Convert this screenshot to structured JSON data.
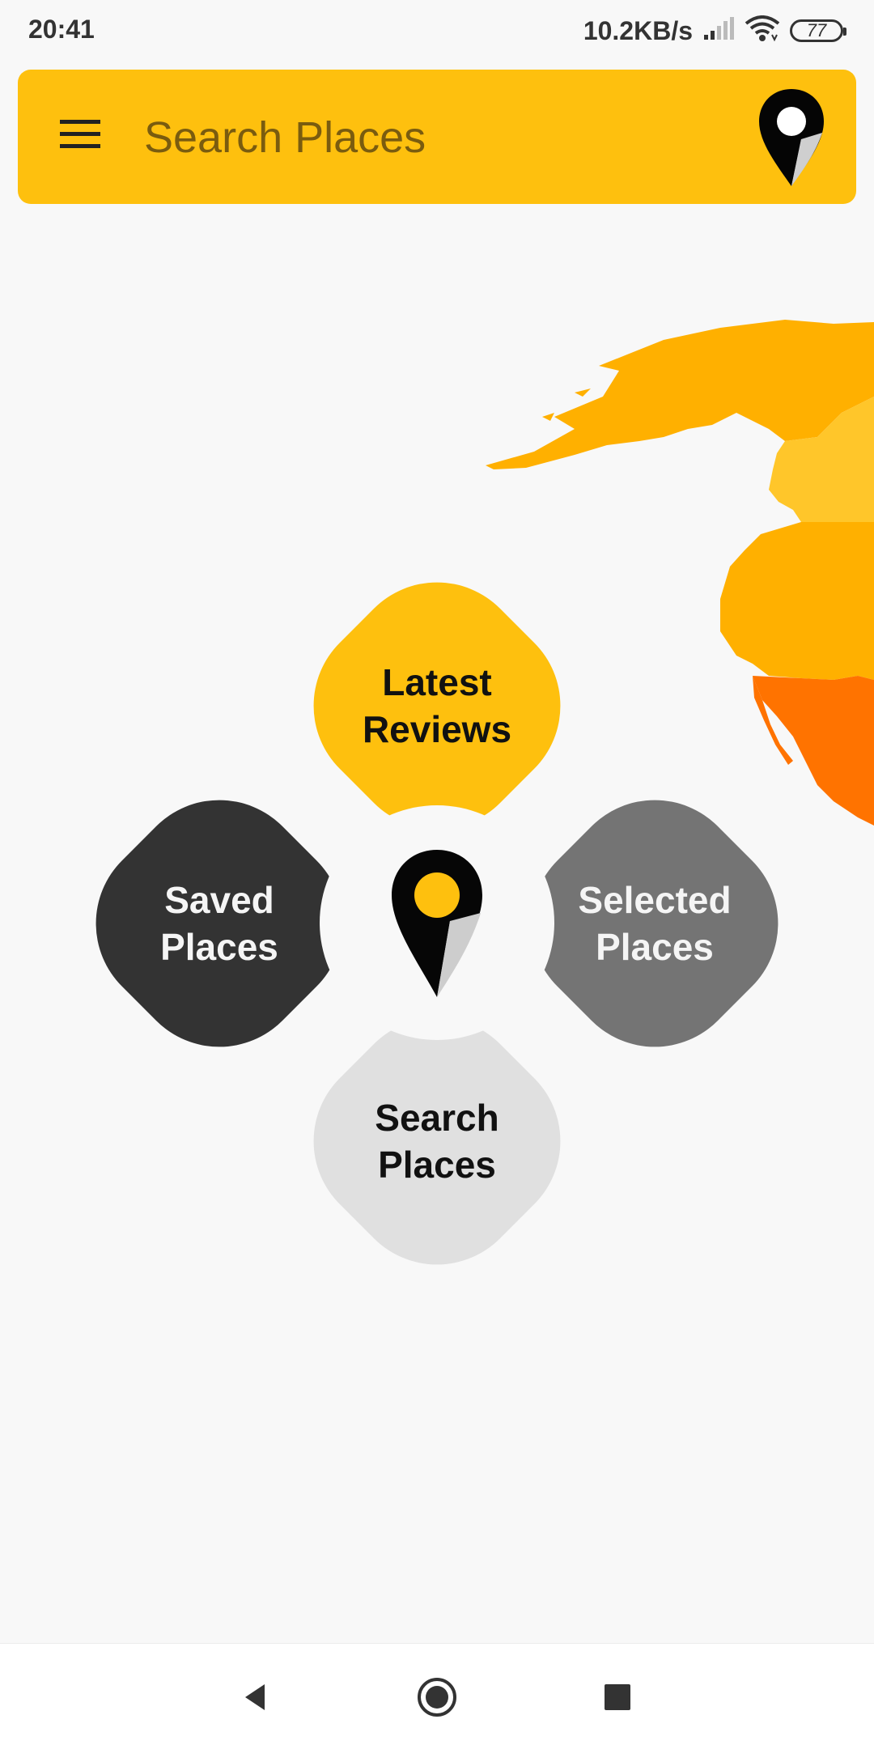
{
  "status_bar": {
    "time": "20:41",
    "net_speed": "10.2KB/s",
    "battery": "77",
    "icons": [
      "signal-icon",
      "wifi-icon",
      "battery-icon"
    ]
  },
  "search_bar": {
    "placeholder": "Search Places",
    "icons": [
      "menu-icon",
      "app-logo-pin-icon"
    ]
  },
  "menu": {
    "top": {
      "line1": "Latest",
      "line2": "Reviews"
    },
    "left": {
      "line1": "Saved",
      "line2": "Places"
    },
    "right": {
      "line1": "Selected",
      "line2": "Places"
    },
    "bottom": {
      "line1": "Search",
      "line2": "Places"
    },
    "center_icon": "location-pin-icon"
  },
  "nav_bar": {
    "icons": [
      "back-icon",
      "home-icon",
      "recent-apps-icon"
    ]
  },
  "colors": {
    "accent": "#fec00e",
    "dark_petal": "#333333",
    "grey_petal": "#747474",
    "light_petal": "#e0e0e0",
    "map_orange": "#ffb000",
    "map_dark_orange": "#ff7300"
  }
}
